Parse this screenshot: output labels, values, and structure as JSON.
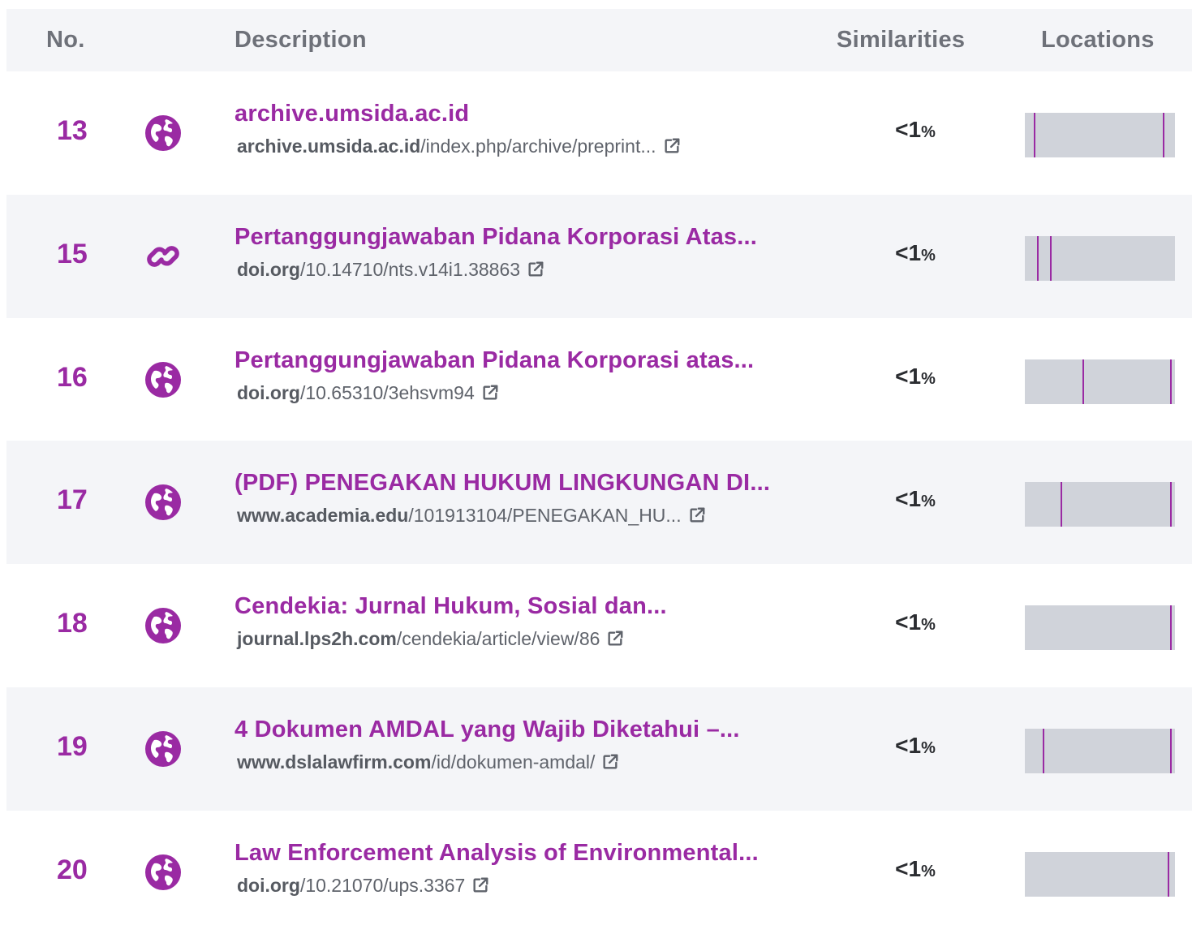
{
  "header": {
    "no": "No.",
    "description": "Description",
    "similarities": "Similarities",
    "locations": "Locations"
  },
  "colors": {
    "accent": "#9a2aa3",
    "bar": "#d0d3da",
    "shade": "#f4f5f8"
  },
  "rows": [
    {
      "num": "13",
      "icon": "globe-icon",
      "title": "archive.umsida.ac.id",
      "url_host": "archive.umsida.ac.id",
      "url_path": "/index.php/archive/preprint...",
      "sim_value": "<1",
      "sim_unit": "%",
      "markers": [
        0.06,
        0.93
      ]
    },
    {
      "num": "15",
      "icon": "link-icon",
      "title": "Pertanggungjawaban Pidana Korporasi Atas...",
      "url_host": "doi.org",
      "url_path": "/10.14710/nts.v14i1.38863",
      "sim_value": "<1",
      "sim_unit": "%",
      "markers": [
        0.08,
        0.17
      ]
    },
    {
      "num": "16",
      "icon": "globe-icon",
      "title": "Pertanggungjawaban Pidana Korporasi atas...",
      "url_host": "doi.org",
      "url_path": "/10.65310/3ehsvm94",
      "sim_value": "<1",
      "sim_unit": "%",
      "markers": [
        0.39,
        0.98
      ]
    },
    {
      "num": "17",
      "icon": "globe-icon",
      "title": "(PDF) PENEGAKAN HUKUM LINGKUNGAN DI...",
      "url_host": "www.academia.edu",
      "url_path": "/101913104/PENEGAKAN_HU...",
      "sim_value": "<1",
      "sim_unit": "%",
      "markers": [
        0.24,
        0.98
      ]
    },
    {
      "num": "18",
      "icon": "globe-icon",
      "title": "Cendekia: Jurnal Hukum, Sosial dan...",
      "url_host": "journal.lps2h.com",
      "url_path": "/cendekia/article/view/86",
      "sim_value": "<1",
      "sim_unit": "%",
      "markers": [
        0.98
      ]
    },
    {
      "num": "19",
      "icon": "globe-icon",
      "title": "4 Dokumen AMDAL yang Wajib Diketahui –...",
      "url_host": "www.dslalawfirm.com",
      "url_path": "/id/dokumen-amdal/",
      "sim_value": "<1",
      "sim_unit": "%",
      "markers": [
        0.12,
        0.98
      ]
    },
    {
      "num": "20",
      "icon": "globe-icon",
      "title": "Law Enforcement Analysis of Environmental...",
      "url_host": "doi.org",
      "url_path": "/10.21070/ups.3367",
      "sim_value": "<1",
      "sim_unit": "%",
      "markers": [
        0.96
      ]
    }
  ]
}
